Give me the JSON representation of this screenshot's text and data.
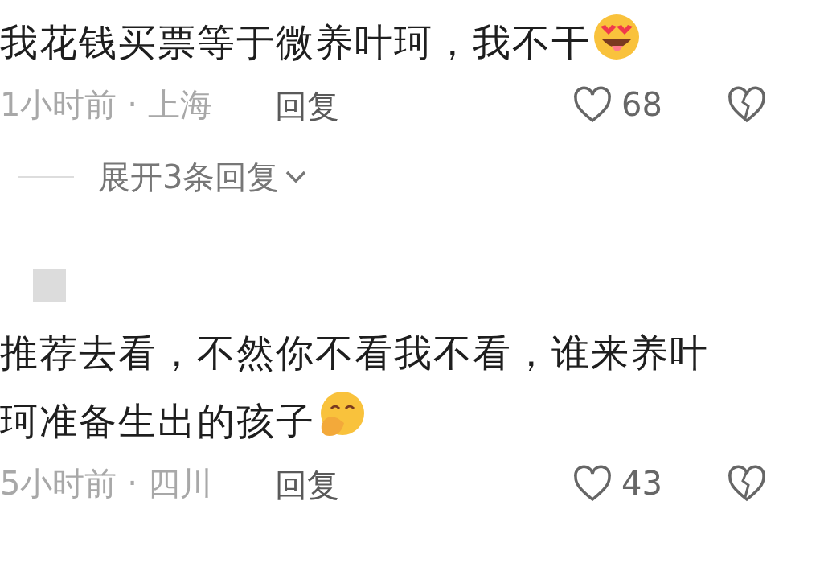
{
  "items": [
    {
      "kind": "comment",
      "text": "我花钱买票等于微养叶珂，我不干",
      "emoji": {
        "kind": "star-struck"
      },
      "time": "1小时前 · 上海",
      "reply": "回复",
      "likes": "68",
      "liked": false,
      "disliked": false
    },
    {
      "kind": "expand_replies",
      "label": "展开3条回复"
    },
    {
      "kind": "comment",
      "show_avatar": true,
      "text": "推荐去看，不然你不看我不看，谁来养叶珂准备生出的孩子",
      "emoji": {
        "kind": "hand-over-mouth"
      },
      "time": "5小时前 · 四川",
      "reply": "回复",
      "likes": "43",
      "liked": false,
      "disliked": false
    }
  ]
}
